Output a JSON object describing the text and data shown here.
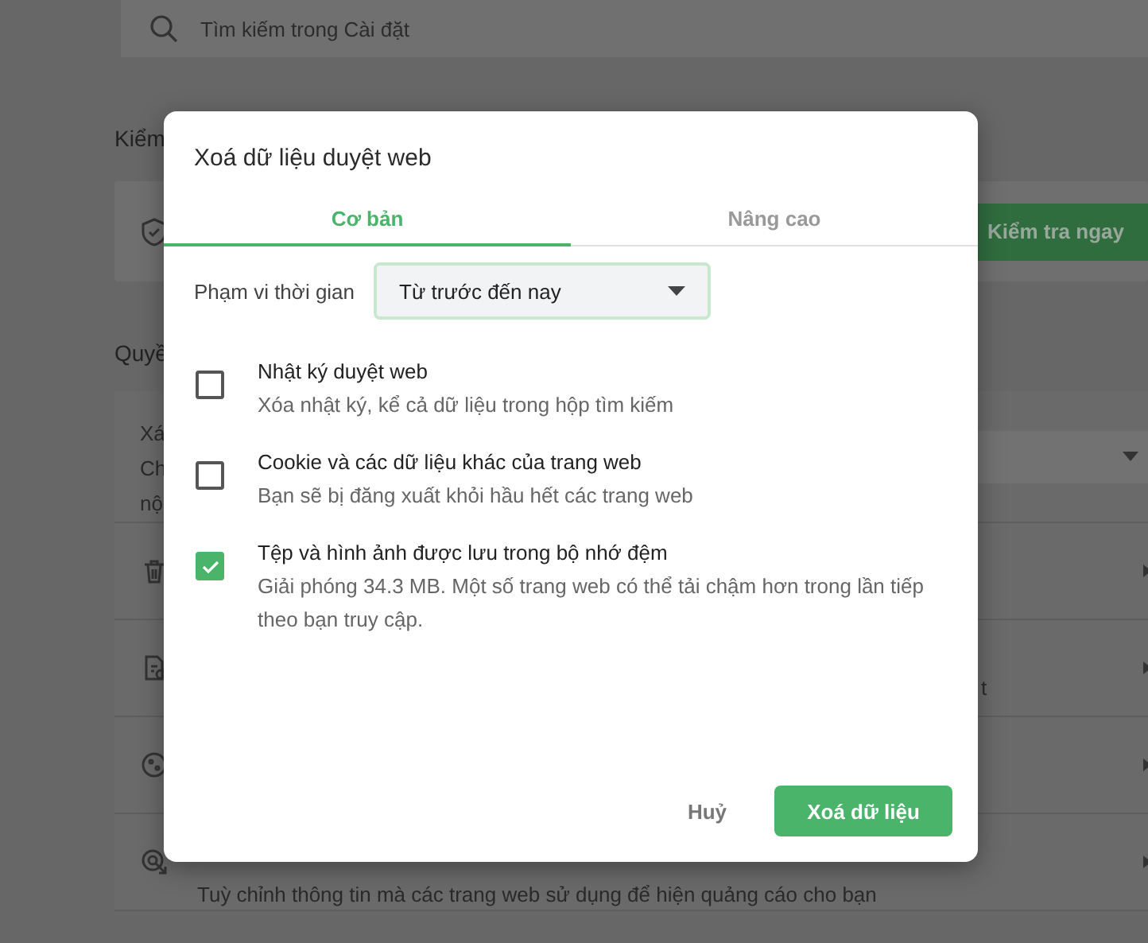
{
  "background": {
    "search": {
      "placeholder": "Tìm kiếm trong Cài đặt"
    },
    "section_1": {
      "heading": "Kiểm",
      "button": "Kiểm tra ngay"
    },
    "section_2": {
      "heading": "Quyề",
      "rows": [
        {
          "kind": "dropdown",
          "lines": [
            "Xá",
            "Ch",
            "nộ"
          ]
        },
        {
          "kind": "icon",
          "lines": []
        },
        {
          "kind": "icon",
          "lines": [
            "t"
          ]
        },
        {
          "kind": "icon",
          "lines": []
        },
        {
          "kind": "icon",
          "lines": [
            "Tuỳ chỉnh thông tin mà các trang web sử dụng để hiện quảng cáo cho bạn"
          ]
        }
      ]
    }
  },
  "dialog": {
    "title": "Xoá dữ liệu duyệt web",
    "tabs": [
      {
        "label": "Cơ bản",
        "selected": true
      },
      {
        "label": "Nâng cao",
        "selected": false
      }
    ],
    "time_range": {
      "label": "Phạm vi thời gian",
      "value": "Từ trước đến nay"
    },
    "options": [
      {
        "title": "Nhật ký duyệt web",
        "description": "Xóa nhật ký, kể cả dữ liệu trong hộp tìm kiếm",
        "checked": false
      },
      {
        "title": "Cookie và các dữ liệu khác của trang web",
        "description": "Bạn sẽ bị đăng xuất khỏi hầu hết các trang web",
        "checked": false
      },
      {
        "title": "Tệp và hình ảnh được lưu trong bộ nhớ đệm",
        "description": "Giải phóng 34.3 MB. Một số trang web có thể tải chậm hơn trong lần tiếp theo bạn truy cập.",
        "checked": true
      }
    ],
    "buttons": {
      "cancel": "Huỷ",
      "confirm": "Xoá dữ liệu"
    }
  }
}
